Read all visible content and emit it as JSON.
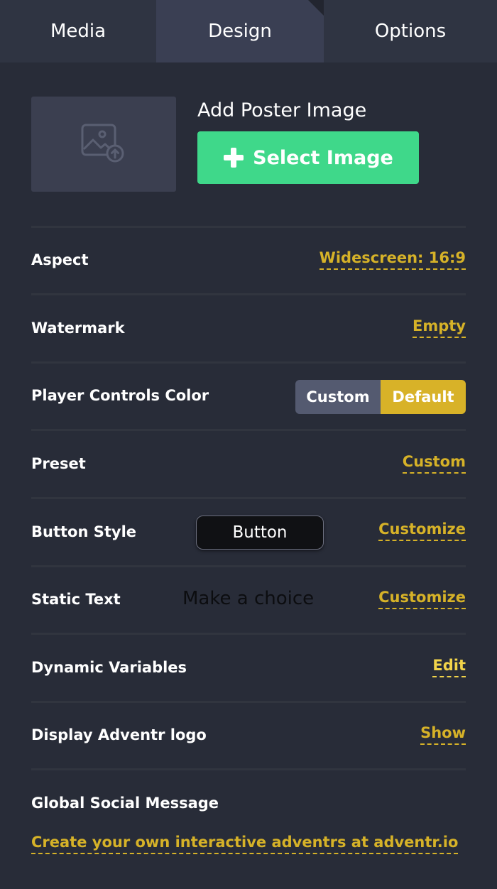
{
  "tabs": {
    "media": "Media",
    "design": "Design",
    "options": "Options"
  },
  "poster": {
    "title": "Add Poster Image",
    "button_label": "Select Image",
    "placeholder_icon": "image-upload-icon",
    "button_icon": "plus-icon"
  },
  "rows": {
    "aspect": {
      "label": "Aspect",
      "value": "Widescreen: 16:9"
    },
    "watermark": {
      "label": "Watermark",
      "value": "Empty"
    },
    "player_controls_color": {
      "label": "Player Controls Color",
      "options": [
        "Custom",
        "Default"
      ],
      "selected": "Default"
    },
    "preset": {
      "label": "Preset",
      "value": "Custom"
    },
    "button_style": {
      "label": "Button Style",
      "preview": "Button",
      "action": "Customize"
    },
    "static_text": {
      "label": "Static Text",
      "preview": "Make a choice",
      "action": "Customize"
    },
    "dynamic_variables": {
      "label": "Dynamic Variables",
      "action": "Edit"
    },
    "display_logo": {
      "label": "Display Adventr logo",
      "value": "Show"
    },
    "global_social_message": {
      "label": "Global Social Message",
      "value": "Create your own interactive adventrs at adventr.io"
    }
  },
  "colors": {
    "background": "#282c38",
    "accent_green": "#3fd88a",
    "accent_gold": "#d6b228",
    "tab_active": "#3a3f53"
  }
}
